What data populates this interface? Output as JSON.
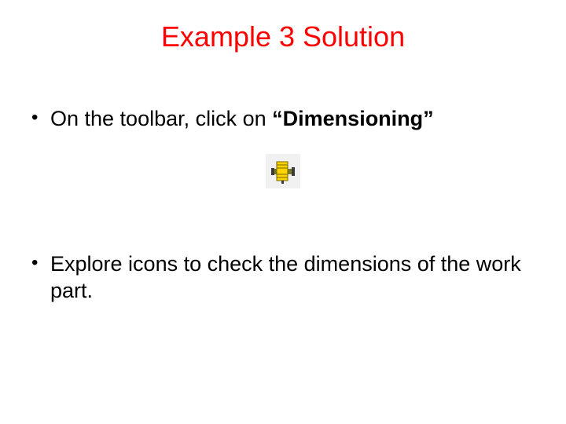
{
  "title": "Example 3 Solution",
  "bullets": {
    "b1_prefix": "On the toolbar, click on ",
    "b1_quoted": "“Dimensioning”",
    "b2": "Explore icons to check the dimensions of the work part."
  },
  "icons": {
    "dimensioning": "dimensioning-tool-icon"
  }
}
